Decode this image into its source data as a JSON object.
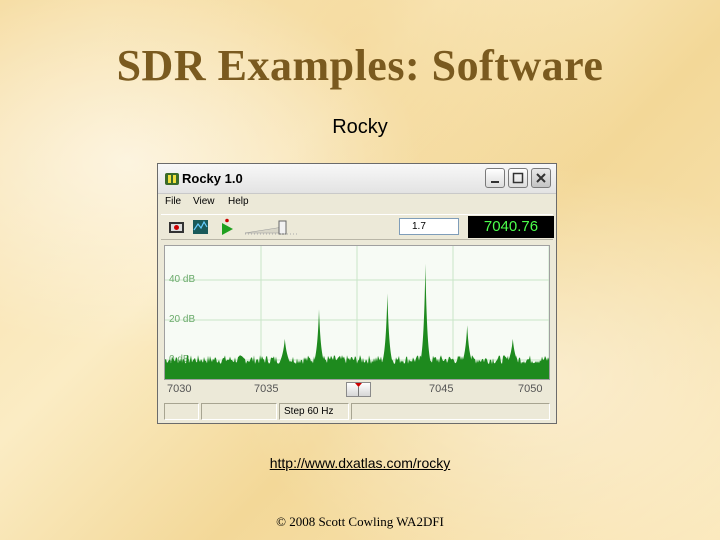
{
  "slide": {
    "title": "SDR Examples: Software",
    "subtitle": "Rocky",
    "link": "http://www.dxatlas.com/rocky",
    "footer": "© 2008 Scott Cowling WA2DFI"
  },
  "window": {
    "title": "Rocky 1.0",
    "menu": [
      "File",
      "View",
      "Help"
    ],
    "toolbar": {
      "gain_value": "1.7",
      "frequency_display": "7040.76",
      "icons": [
        "record-icon",
        "waterfall-icon",
        "play-icon",
        "volume-slider"
      ]
    },
    "spectrum": {
      "db_labels": [
        "40 dB",
        "20 dB",
        "0 dB"
      ],
      "freq_labels": [
        "7030",
        "7035",
        "7045",
        "7050"
      ],
      "x_range_khz": [
        7030,
        7050
      ],
      "peaks_khz": [
        7036.2,
        7038.0,
        7041.6,
        7043.6,
        7045.8,
        7048.2
      ]
    },
    "status": {
      "step": "Step 60 Hz"
    },
    "colors": {
      "trace": "#1e8a1e",
      "freq_digits": "#4cff4c",
      "plot_grid": "#c8e6c8"
    }
  }
}
